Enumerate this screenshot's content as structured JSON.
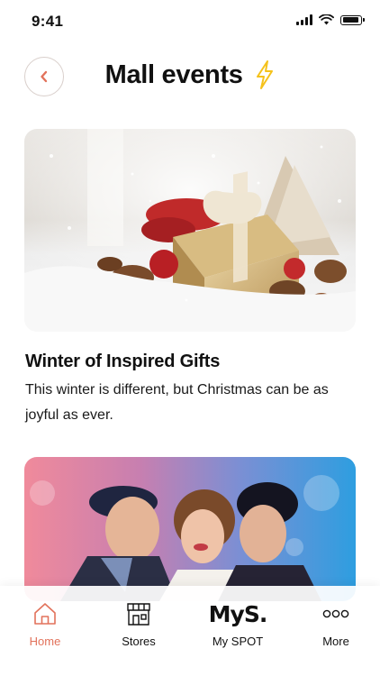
{
  "status_bar": {
    "time": "9:41"
  },
  "header": {
    "title": "Mall events",
    "title_icon": "lightning-bolt-icon",
    "back_icon": "chevron-left-icon"
  },
  "events": [
    {
      "title": "Winter of Inspired Gifts",
      "description": "This winter is different, but Christmas can be as joyful as ever."
    }
  ],
  "nav": {
    "items": [
      {
        "label": "Home",
        "icon": "home-icon",
        "active": true
      },
      {
        "label": "Stores",
        "icon": "store-icon",
        "active": false
      },
      {
        "label": "My SPOT",
        "icon": "myspot-logo",
        "logo_text": "MyS.",
        "active": false
      },
      {
        "label": "More",
        "icon": "more-dots-icon",
        "active": false
      }
    ]
  },
  "colors": {
    "accent": "#e2725b",
    "bolt": "#f5c21b",
    "text": "#111111"
  }
}
